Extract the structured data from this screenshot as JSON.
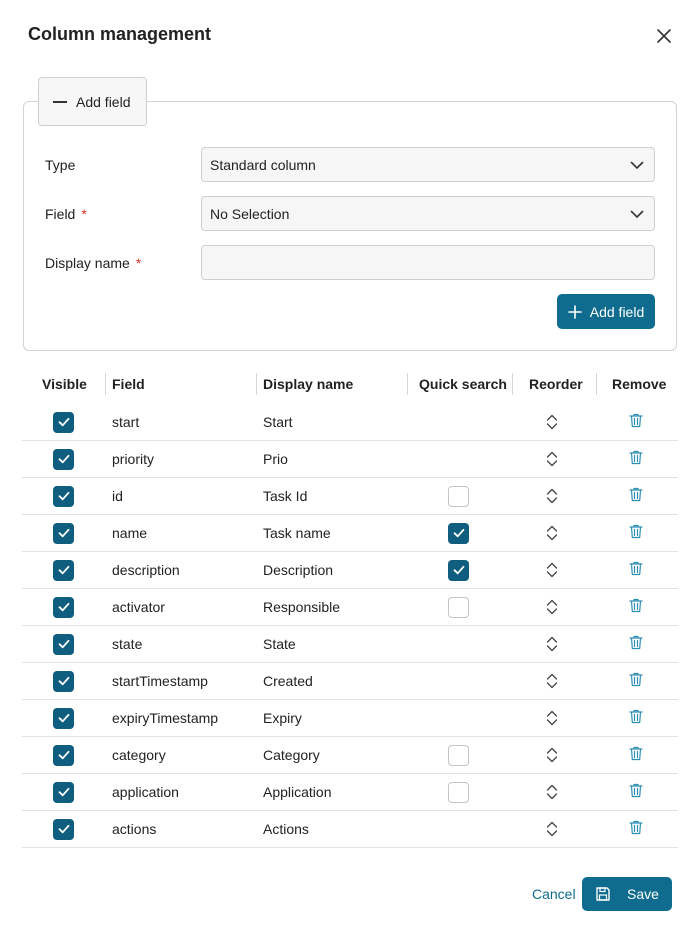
{
  "dialog": {
    "title": "Column management"
  },
  "add_field_panel": {
    "tab_label": "Add field",
    "type_label": "Type",
    "type_value": "Standard column",
    "field_label": "Field",
    "field_value": "No Selection",
    "display_name_label": "Display name",
    "display_name_value": "",
    "required_mark": "*",
    "add_button_label": "Add field"
  },
  "table": {
    "headers": {
      "visible": "Visible",
      "field": "Field",
      "display_name": "Display name",
      "quick_search": "Quick search",
      "reorder": "Reorder",
      "remove": "Remove"
    },
    "rows": [
      {
        "field": "start",
        "display_name": "Start",
        "visible": true,
        "quick_search": null
      },
      {
        "field": "priority",
        "display_name": "Prio",
        "visible": true,
        "quick_search": null
      },
      {
        "field": "id",
        "display_name": "Task Id",
        "visible": true,
        "quick_search": false
      },
      {
        "field": "name",
        "display_name": "Task name",
        "visible": true,
        "quick_search": true
      },
      {
        "field": "description",
        "display_name": "Description",
        "visible": true,
        "quick_search": true
      },
      {
        "field": "activator",
        "display_name": "Responsible",
        "visible": true,
        "quick_search": false
      },
      {
        "field": "state",
        "display_name": "State",
        "visible": true,
        "quick_search": null
      },
      {
        "field": "startTimestamp",
        "display_name": "Created",
        "visible": true,
        "quick_search": null
      },
      {
        "field": "expiryTimestamp",
        "display_name": "Expiry",
        "visible": true,
        "quick_search": null
      },
      {
        "field": "category",
        "display_name": "Category",
        "visible": true,
        "quick_search": false
      },
      {
        "field": "application",
        "display_name": "Application",
        "visible": true,
        "quick_search": false
      },
      {
        "field": "actions",
        "display_name": "Actions",
        "visible": true,
        "quick_search": null
      }
    ]
  },
  "footer": {
    "cancel_label": "Cancel",
    "save_label": "Save"
  },
  "icons": {
    "close": "close-icon",
    "chevron": "chevron-down-icon",
    "plus": "plus-icon",
    "minus": "minus-icon",
    "reorder": "reorder-icon",
    "trash": "trash-icon",
    "save": "floppy-disk-icon",
    "check": "checkmark-icon"
  },
  "colors": {
    "accent": "#0f6c8e",
    "checkbox": "#0f5e80",
    "required": "#d0342c",
    "trash": "#2d8fb3"
  }
}
